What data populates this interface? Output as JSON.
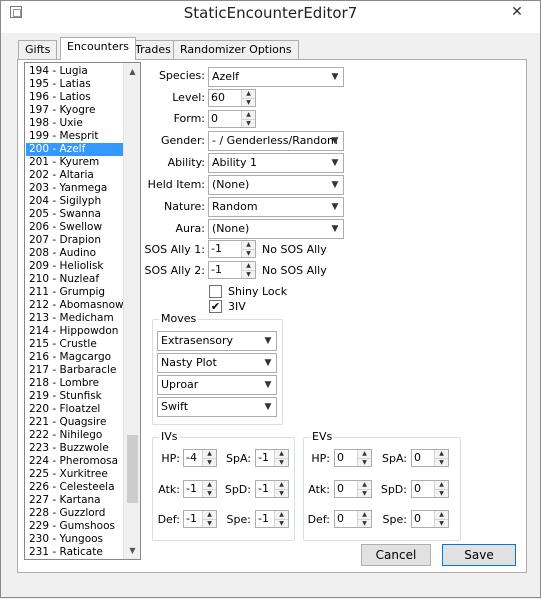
{
  "window": {
    "title": "StaticEncounterEditor7",
    "close_glyph": "✕"
  },
  "tabs": [
    {
      "label": "Gifts"
    },
    {
      "label": "Encounters"
    },
    {
      "label": "Trades"
    },
    {
      "label": "Randomizer Options"
    }
  ],
  "encounter_list": {
    "items": [
      "194 - Lugia",
      "195 - Latias",
      "196 - Latios",
      "197 - Kyogre",
      "198 - Uxie",
      "199 - Mesprit",
      "200 - Azelf",
      "201 - Kyurem",
      "202 - Altaria",
      "203 - Yanmega",
      "204 - Sigilyph",
      "205 - Swanna",
      "206 - Swellow",
      "207 - Drapion",
      "208 - Audino",
      "209 - Heliolisk",
      "210 - Nuzleaf",
      "211 - Grumpig",
      "212 - Abomasnow",
      "213 - Medicham",
      "214 - Hippowdon",
      "215 - Crustle",
      "216 - Magcargo",
      "217 - Barbaracle",
      "218 - Lombre",
      "219 - Stunfisk",
      "220 - Floatzel",
      "221 - Quagsire",
      "222 - Nihilego",
      "223 - Buzzwole",
      "224 - Pheromosa",
      "225 - Xurkitree",
      "226 - Celesteela",
      "227 - Kartana",
      "228 - Guzzlord",
      "229 - Gumshoos",
      "230 - Yungoos",
      "231 - Raticate"
    ],
    "selected": "200 - Azelf",
    "scroll_up": "▲",
    "scroll_down": "▼"
  },
  "form": {
    "species_label": "Species:",
    "species_value": "Azelf",
    "level_label": "Level:",
    "level_value": "60",
    "form_label": "Form:",
    "form_value": "0",
    "gender_label": "Gender:",
    "gender_value": "- / Genderless/Random",
    "ability_label": "Ability:",
    "ability_value": "Ability 1",
    "helditem_label": "Held Item:",
    "helditem_value": "(None)",
    "nature_label": "Nature:",
    "nature_value": "Random",
    "aura_label": "Aura:",
    "aura_value": "(None)",
    "sos1_label": "SOS Ally 1:",
    "sos1_value": "-1",
    "sos1_text": "No SOS Ally",
    "sos2_label": "SOS Ally 2:",
    "sos2_value": "-1",
    "sos2_text": "No SOS Ally",
    "shinylock_label": "Shiny Lock",
    "shinylock_checked": false,
    "threeiv_label": "3IV",
    "threeiv_checked": true,
    "check_glyph": "✔"
  },
  "moves": {
    "title": "Moves",
    "items": [
      "Extrasensory",
      "Nasty Plot",
      "Uproar",
      "Swift"
    ]
  },
  "ivs": {
    "title": "IVs",
    "hp_label": "HP:",
    "hp": "-4",
    "atk_label": "Atk:",
    "atk": "-1",
    "def_label": "Def:",
    "def": "-1",
    "spa_label": "SpA:",
    "spa": "-1",
    "spd_label": "SpD:",
    "spd": "-1",
    "spe_label": "Spe:",
    "spe": "-1"
  },
  "evs": {
    "title": "EVs",
    "hp_label": "HP:",
    "hp": "0",
    "atk_label": "Atk:",
    "atk": "0",
    "def_label": "Def:",
    "def": "0",
    "spa_label": "SpA:",
    "spa": "0",
    "spd_label": "SpD:",
    "spd": "0",
    "spe_label": "Spe:",
    "spe": "0"
  },
  "buttons": {
    "cancel": "Cancel",
    "save": "Save"
  },
  "glyphs": {
    "dropdown": "▼",
    "spin_up": "▲",
    "spin_down": "▼"
  },
  "colors": {
    "selection": "#3399ff",
    "default_button_border": "#0078d7"
  }
}
